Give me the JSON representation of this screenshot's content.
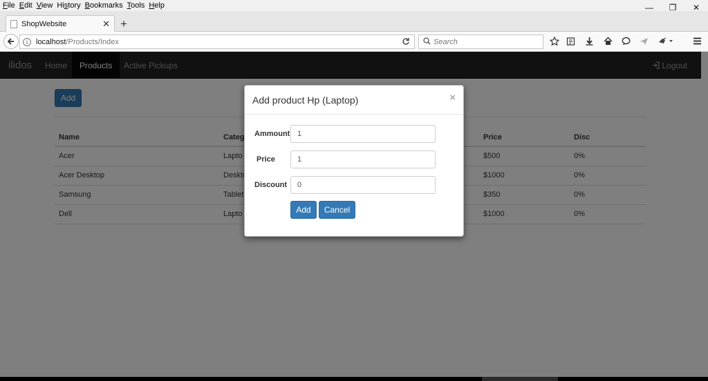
{
  "browser": {
    "menu": [
      {
        "ul": "F",
        "rest": "ile"
      },
      {
        "ul": "E",
        "rest": "dit"
      },
      {
        "ul": "V",
        "rest": "iew"
      },
      {
        "ul": "",
        "rest": "Hi",
        "ul2": "s",
        "rest2": "tory"
      },
      {
        "ul": "B",
        "rest": "ookmarks"
      },
      {
        "ul": "T",
        "rest": "ools"
      },
      {
        "ul": "H",
        "rest": "elp"
      }
    ],
    "window_controls": {
      "minimize": "—",
      "restore": "❐",
      "close": "✕"
    },
    "tab_title": "ShopWebsite",
    "tab_close": "✕",
    "new_tab": "+",
    "url_host": "localhost",
    "url_path": "/Products/Index",
    "search_placeholder": "Search",
    "icons": {
      "back": "arrow-left",
      "info": "info",
      "reload": "reload",
      "search": "magnifier",
      "bookmark": "star",
      "reading": "clipboard",
      "download": "arrow-down",
      "home": "house",
      "chat": "speech-bubble",
      "send": "paper-plane",
      "ext": "plugin",
      "menu": "hamburger"
    }
  },
  "site": {
    "brand": "ilidos",
    "nav": [
      "Home",
      "Products",
      "Active Pickups"
    ],
    "logout": "Logout",
    "add_button": "Add"
  },
  "table": {
    "headers": [
      "Name",
      "Categ",
      "Price",
      "Disc"
    ],
    "rows": [
      [
        "Acer",
        "Lapto",
        "$500",
        "0%"
      ],
      [
        "Acer Desktop",
        "Deskto",
        "$1000",
        "0%"
      ],
      [
        "Samsung",
        "Tablet",
        "$350",
        "0%"
      ],
      [
        "Dell",
        "Lapto",
        "$1000",
        "0%"
      ]
    ]
  },
  "modal": {
    "title": "Add product Hp (Laptop)",
    "close": "×",
    "fields": [
      {
        "label": "Ammount",
        "value": "1"
      },
      {
        "label": "Price",
        "value": "1"
      },
      {
        "label": "Discount",
        "value": "0"
      }
    ],
    "add_label": "Add",
    "cancel_label": "Cancel"
  },
  "colors": {
    "primary": "#337ab7",
    "navbar": "#222222",
    "backdrop_opacity": 0.5
  }
}
